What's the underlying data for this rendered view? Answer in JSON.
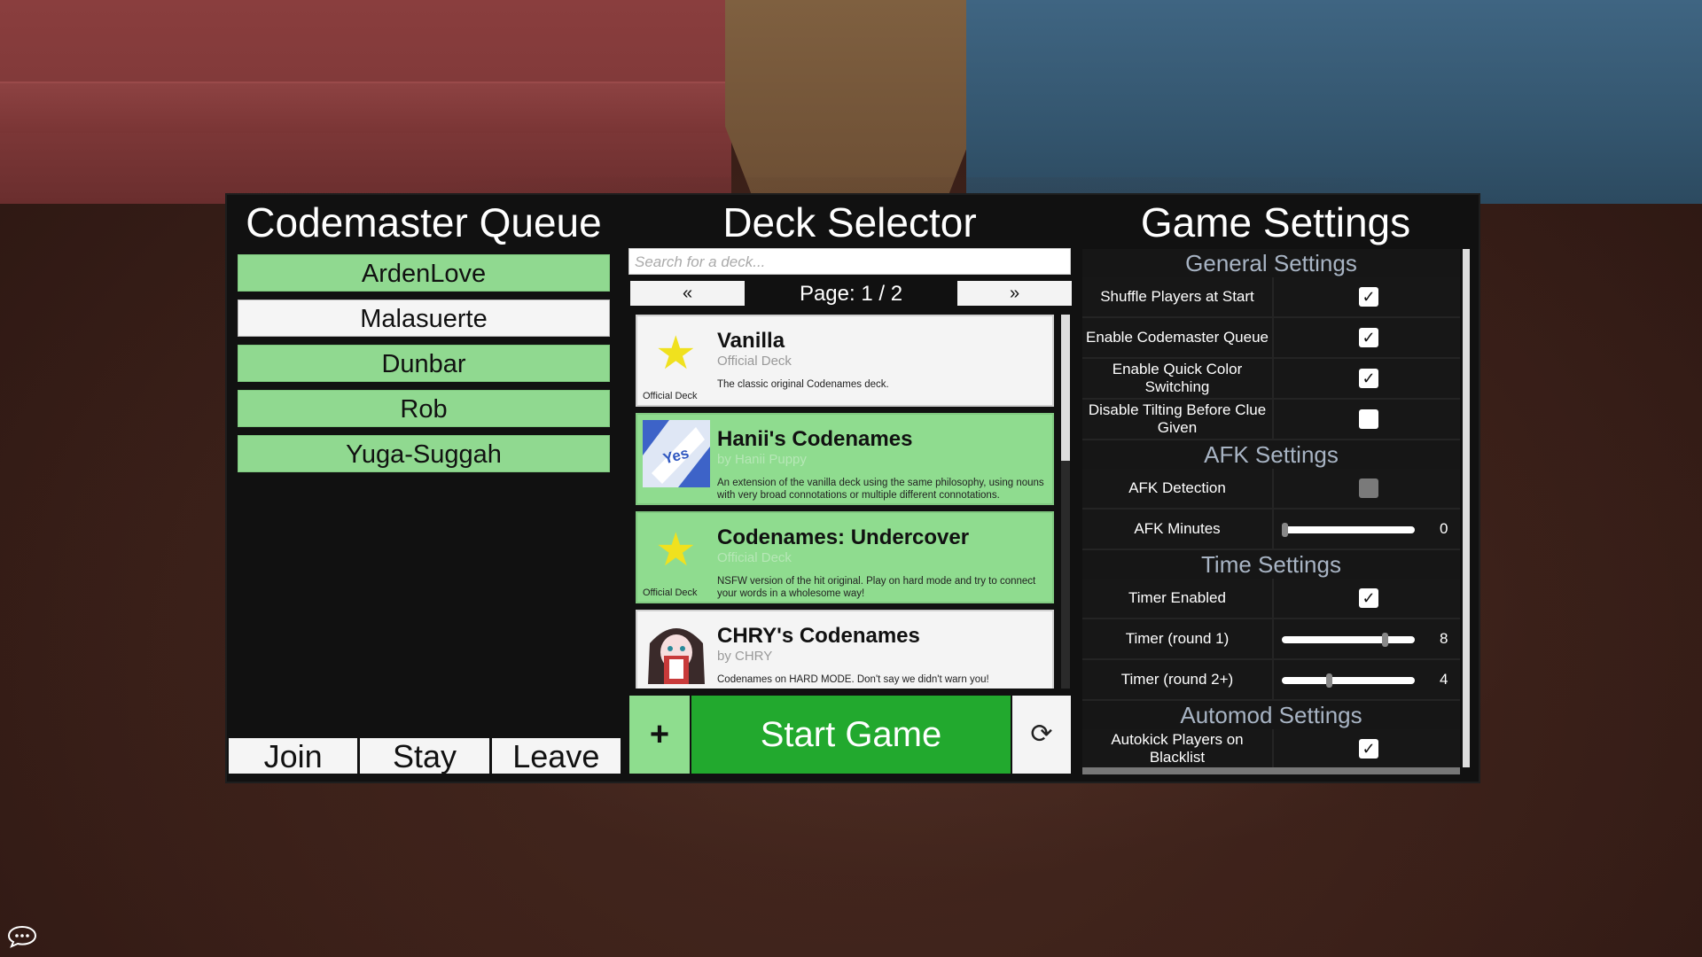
{
  "queue": {
    "title": "Codemaster Queue",
    "players": [
      {
        "name": "ArdenLove",
        "color": "#90d990"
      },
      {
        "name": "Malasuerte",
        "color": "#f5f5f5"
      },
      {
        "name": "Dunbar",
        "color": "#90d990"
      },
      {
        "name": "Rob",
        "color": "#90d990"
      },
      {
        "name": "Yuga-Suggah",
        "color": "#90d990"
      }
    ],
    "join_label": "Join",
    "stay_label": "Stay",
    "leave_label": "Leave"
  },
  "deck": {
    "title": "Deck Selector",
    "search_placeholder": "Search for a deck...",
    "prev_label": "«",
    "next_label": "»",
    "page_text": "Page: 1 / 2",
    "cards": [
      {
        "name": "Vanilla",
        "author": "Official Deck",
        "desc": "The classic original Codenames deck.",
        "icon": "star-icon",
        "icon_label": "Official Deck",
        "selected": false
      },
      {
        "name": "Hanii's Codenames",
        "author": "by Hanii Puppy",
        "desc": "An extension of the vanilla deck using the same philosophy, using nouns with very broad connotations or multiple different connotations.",
        "icon": "hanii-yes-icon",
        "icon_label": "",
        "selected": true
      },
      {
        "name": "Codenames: Undercover",
        "author": "Official Deck",
        "desc": "NSFW version of the hit original. Play on hard mode and try to connect your words in a wholesome way!",
        "icon": "star-icon",
        "icon_label": "Official Deck",
        "selected": true
      },
      {
        "name": "CHRY's Codenames",
        "author": "by CHRY",
        "desc": "Codenames on HARD MODE. Don't say we didn't warn you!",
        "icon": "chry-avatar-icon",
        "icon_label": "",
        "selected": false
      }
    ],
    "plus_label": "+",
    "start_label": "Start Game",
    "refresh_icon": "refresh-icon",
    "refresh_glyph": "⟳"
  },
  "settings": {
    "title": "Game Settings",
    "general": {
      "title": "General Settings",
      "shuffle_label": "Shuffle Players at Start",
      "shuffle": true,
      "queue_label": "Enable Codemaster Queue",
      "queue": true,
      "quickcolor_label": "Enable Quick Color Switching",
      "quickcolor": true,
      "tilting_label": "Disable Tilting Before Clue Given",
      "tilting": false
    },
    "afk": {
      "title": "AFK Settings",
      "detection_label": "AFK Detection",
      "detection": false,
      "minutes_label": "AFK Minutes",
      "minutes": 0,
      "minutes_max": 30,
      "minutes_value": "0"
    },
    "time": {
      "title": "Time Settings",
      "enabled_label": "Timer Enabled",
      "enabled": true,
      "round1_label": "Timer (round 1)",
      "round1": 8,
      "round1_level": 0.77,
      "round1_value": "8",
      "round2_label": "Timer (round 2+)",
      "round2": 4,
      "round2_level": 0.35,
      "round2_value": "4"
    },
    "automod": {
      "title": "Automod Settings",
      "autokick_label": "Autokick Players on Blacklist",
      "autokick": true
    },
    "check_glyph": "✓"
  },
  "chat_icon": "chat-bubble-icon",
  "colors": {
    "green": "#22a92e",
    "light_green": "#8edd8e",
    "panel": "#111111"
  }
}
